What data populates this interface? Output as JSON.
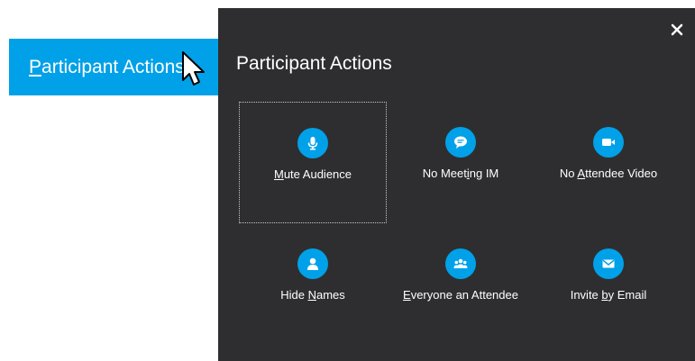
{
  "trigger": {
    "label": "Participant Actions",
    "mnemonic_index": 0
  },
  "panel": {
    "title": "Participant Actions",
    "close_icon": "close-icon",
    "actions": [
      {
        "label": "Mute Audience",
        "mnemonic_index": 0,
        "icon": "microphone-icon",
        "focused": true
      },
      {
        "label": "No Meeting IM",
        "mnemonic_index": 7,
        "icon": "chat-bubble-icon",
        "focused": false
      },
      {
        "label": "No Attendee Video",
        "mnemonic_index": 3,
        "icon": "video-camera-icon",
        "focused": false
      },
      {
        "label": "Hide Names",
        "mnemonic_index": 5,
        "icon": "person-icon",
        "focused": false
      },
      {
        "label": "Everyone an Attendee",
        "mnemonic_index": 0,
        "icon": "group-icon",
        "focused": false
      },
      {
        "label": "Invite by Email",
        "mnemonic_index": 7,
        "icon": "envelope-icon",
        "focused": false
      }
    ]
  },
  "colors": {
    "accent": "#00a1e8",
    "panel_background": "#2e2e30",
    "text": "#ffffff"
  }
}
